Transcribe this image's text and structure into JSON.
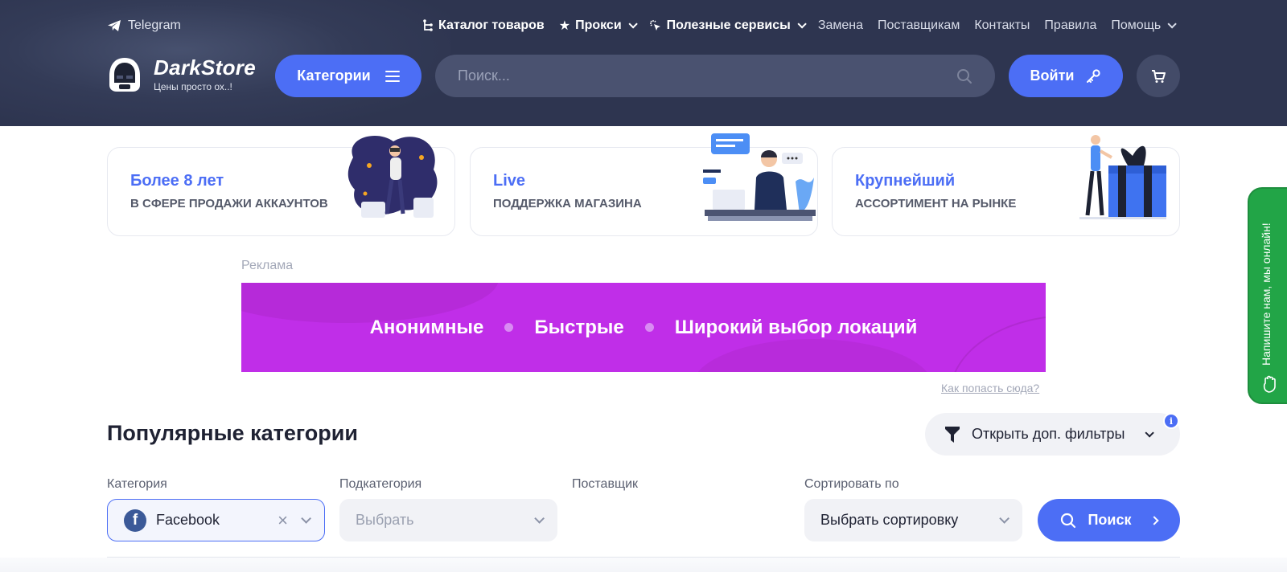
{
  "header": {
    "telegram_label": "Telegram",
    "nav": [
      {
        "label": "Каталог товаров",
        "icon": "tree-icon",
        "bold": true
      },
      {
        "label": "Прокси",
        "icon": "star-icon",
        "bold": true,
        "dropdown": true
      },
      {
        "label": "Полезные сервисы",
        "icon": "cursor-click-icon",
        "bold": true,
        "dropdown": true
      },
      {
        "label": "Замена"
      },
      {
        "label": "Поставщикам"
      },
      {
        "label": "Контакты"
      },
      {
        "label": "Правила"
      },
      {
        "label": "Помощь",
        "dropdown": true
      }
    ],
    "logo_name": "DarkStore",
    "logo_tagline": "Цены просто ох..!",
    "categories_button": "Категории",
    "search_placeholder": "Поиск...",
    "login_button": "Войти"
  },
  "features": [
    {
      "title": "Более 8 лет",
      "subtitle": "В СФЕРЕ ПРОДАЖИ АККАУНТОВ"
    },
    {
      "title": "Live",
      "subtitle": "ПОДДЕРЖКА МАГАЗИНА"
    },
    {
      "title": "Крупнейший",
      "subtitle": "АССОРТИМЕНТ НА РЫНКЕ"
    }
  ],
  "ad": {
    "label": "Реклама",
    "banner_items": [
      "Анонимные",
      "Быстрые",
      "Широкий выбор локаций"
    ],
    "link": "Как попасть сюда?"
  },
  "side_tab": "Напишите нам, мы онлайн!",
  "popular": {
    "title": "Популярные категории",
    "filters_button": "Открыть доп. фильтры",
    "info_badge": "i"
  },
  "filters": {
    "category_label": "Категория",
    "category_value": "Facebook",
    "subcategory_label": "Подкатегория",
    "subcategory_placeholder": "Выбрать",
    "supplier_label": "Поставщик",
    "sort_label": "Сортировать по",
    "sort_value": "Выбрать сортировку",
    "search_button": "Поиск"
  },
  "colors": {
    "header_bg": "#2e3550",
    "accent": "#4c6ef5",
    "banner": "#c02ee8",
    "side_tab": "#22a547"
  }
}
